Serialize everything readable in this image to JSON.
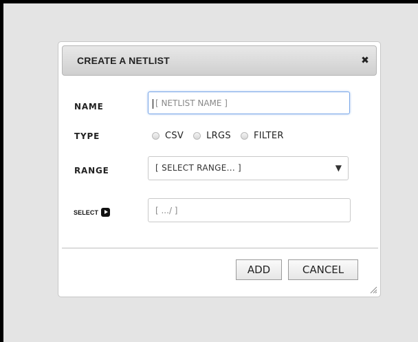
{
  "dialog": {
    "title": "CREATE A NETLIST",
    "close_icon": "close-icon",
    "close_glyph": "✖"
  },
  "form": {
    "name_label": "NAME",
    "name_placeholder": "[ NETLIST NAME ]",
    "type_label": "TYPE",
    "type_options": [
      "CSV",
      "LRGS",
      "FILTER"
    ],
    "range_label": "RANGE",
    "range_value": "[ SELECT RANGE... ]",
    "range_arrow": "▼",
    "select_label": "SELECT",
    "select_icon": "play-icon",
    "select_placeholder": "[ .../ ]"
  },
  "buttons": {
    "add": "ADD",
    "cancel": "CANCEL"
  }
}
